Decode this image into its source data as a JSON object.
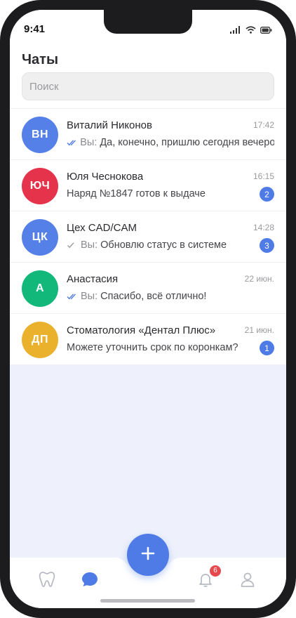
{
  "status": {
    "time": "9:41"
  },
  "header": {
    "title": "Чаты"
  },
  "search": {
    "placeholder": "Поиск"
  },
  "chats": [
    {
      "initials": "ВН",
      "color": "#5580e8",
      "name": "Виталий Никонов",
      "time": "17:42",
      "checks": "double",
      "you": "Вы:",
      "text": "Да, конечно, пришлю сегодня вечером",
      "badge": ""
    },
    {
      "initials": "ЮЧ",
      "color": "#e6334c",
      "name": "Юля Чеснокова",
      "time": "16:15",
      "checks": "",
      "you": "",
      "text": "Наряд №1847 готов к выдаче",
      "badge": "2"
    },
    {
      "initials": "ЦК",
      "color": "#5580e8",
      "name": "Цех CAD/CAM",
      "time": "14:28",
      "checks": "single",
      "you": "Вы:",
      "text": "Обновлю статус в системе",
      "badge": "3"
    },
    {
      "initials": "А",
      "color": "#12b87a",
      "name": "Анастасия",
      "time": "22 июн.",
      "checks": "double",
      "you": "Вы:",
      "text": "Спасибо, всё отлично!",
      "badge": ""
    },
    {
      "initials": "ДП",
      "color": "#eab22c",
      "name": "Стоматология «Дентал Плюс»",
      "time": "21 июн.",
      "checks": "",
      "you": "",
      "text": "Можете уточнить срок по коронкам?",
      "badge": "1"
    }
  ],
  "tabbar": {
    "items": [
      "tooth-icon",
      "chat-icon",
      "bell-icon",
      "profile-icon"
    ],
    "notifications_count": "6",
    "active": "chat-icon"
  },
  "colors": {
    "accent": "#4e7be6",
    "alert": "#e5484d"
  }
}
